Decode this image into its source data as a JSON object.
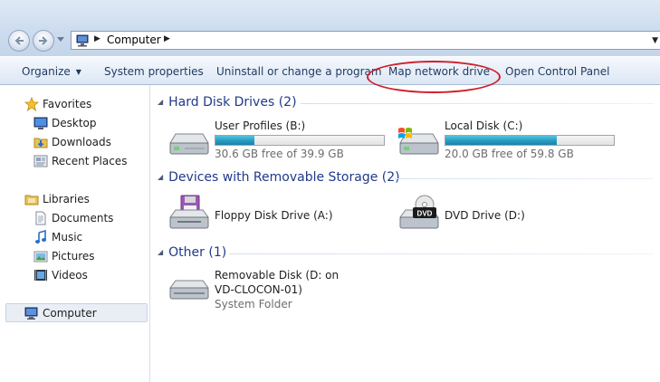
{
  "address": {
    "location": "Computer"
  },
  "toolbar": {
    "organize": "Organize",
    "system_properties": "System properties",
    "uninstall": "Uninstall or change a program",
    "map_network": "Map network drive",
    "control_panel": "Open Control Panel"
  },
  "nav": {
    "favorites": "Favorites",
    "desktop": "Desktop",
    "downloads": "Downloads",
    "recent": "Recent Places",
    "libraries": "Libraries",
    "documents": "Documents",
    "music": "Music",
    "pictures": "Pictures",
    "videos": "Videos",
    "computer": "Computer"
  },
  "groups": {
    "hdd": "Hard Disk Drives (2)",
    "removable": "Devices with Removable Storage (2)",
    "other": "Other (1)"
  },
  "drives": {
    "user_profiles": {
      "name": "User Profiles (B:)",
      "free": "30.6 GB free of 39.9 GB",
      "used_fraction": 0.23
    },
    "local_disk": {
      "name": "Local Disk (C:)",
      "free": "20.0 GB free of 59.8 GB",
      "used_fraction": 0.66
    },
    "floppy": {
      "name": "Floppy Disk Drive (A:)"
    },
    "dvd": {
      "name": "DVD Drive (D:)"
    },
    "removable": {
      "name_line1": "Removable Disk (D: on",
      "name_line2": "VD-CLOCON-01)",
      "type": "System Folder"
    }
  },
  "colors": {
    "highlight_ring": "#d0202a",
    "bar_fill": "#2a9fc4",
    "group_header": "#1e3a8a"
  }
}
